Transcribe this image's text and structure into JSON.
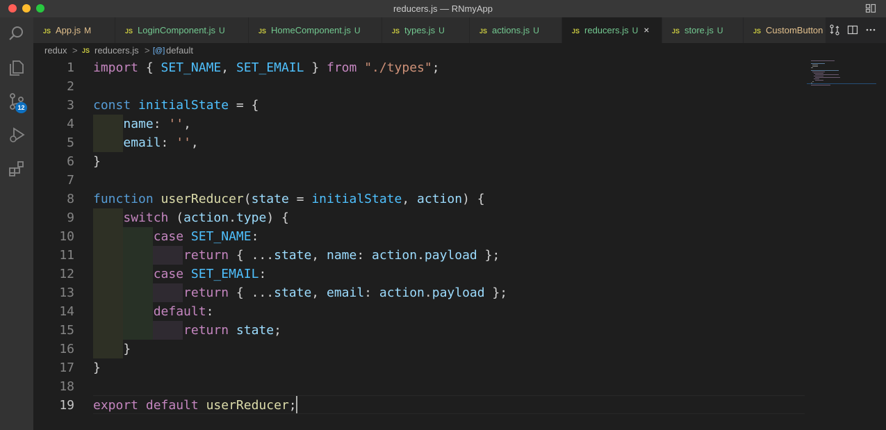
{
  "window": {
    "title": "reducers.js — RNmyApp"
  },
  "colors": {
    "accent": "#0e70c0",
    "modified": "#e2c08d",
    "untracked": "#73c991"
  },
  "activity_bar": {
    "items": [
      {
        "name": "explorer-icon"
      },
      {
        "name": "search-icon"
      },
      {
        "name": "source-control-icon"
      },
      {
        "name": "run-debug-icon"
      },
      {
        "name": "extensions-icon"
      }
    ],
    "source_control_badge": "12"
  },
  "tabs": [
    {
      "label": "App.js",
      "status": "M"
    },
    {
      "label": "LoginComponent.js",
      "status": "U"
    },
    {
      "label": "HomeComponent.js",
      "status": "U"
    },
    {
      "label": "types.js",
      "status": "U"
    },
    {
      "label": "actions.js",
      "status": "U"
    },
    {
      "label": "reducers.js",
      "status": "U",
      "active": true
    },
    {
      "label": "store.js",
      "status": "U"
    },
    {
      "label": "CustomButton",
      "status": ""
    }
  ],
  "tab_icon_label": "JS",
  "tab_close": "×",
  "breadcrumb": {
    "folder": "redux",
    "file": "reducers.js",
    "symbol": "default",
    "file_icon": "JS",
    "symbol_icon": "[@]",
    "separator": ">"
  },
  "editor": {
    "line_numbers": [
      "1",
      "2",
      "3",
      "4",
      "5",
      "6",
      "7",
      "8",
      "9",
      "10",
      "11",
      "12",
      "13",
      "14",
      "15",
      "16",
      "17",
      "18",
      "19"
    ],
    "current_line": "19",
    "lines": [
      {
        "tokens": [
          [
            "kw",
            "import"
          ],
          [
            "pn",
            " { "
          ],
          [
            "cn",
            "SET_NAME"
          ],
          [
            "pn",
            ", "
          ],
          [
            "cn",
            "SET_EMAIL"
          ],
          [
            "pn",
            " } "
          ],
          [
            "kw",
            "from"
          ],
          [
            "pn",
            " "
          ],
          [
            "str",
            "\"./types\""
          ],
          [
            "pn",
            ";"
          ]
        ]
      },
      {
        "tokens": []
      },
      {
        "tokens": [
          [
            "kb",
            "const"
          ],
          [
            "pn",
            " "
          ],
          [
            "cn",
            "initialState"
          ],
          [
            "pn",
            " = {"
          ]
        ]
      },
      {
        "tokens": [
          [
            "pn",
            "    "
          ],
          [
            "vr",
            "name"
          ],
          [
            "pn",
            ": "
          ],
          [
            "str",
            "''"
          ],
          [
            "pn",
            ","
          ]
        ]
      },
      {
        "tokens": [
          [
            "pn",
            "    "
          ],
          [
            "vr",
            "email"
          ],
          [
            "pn",
            ": "
          ],
          [
            "str",
            "''"
          ],
          [
            "pn",
            ","
          ]
        ]
      },
      {
        "tokens": [
          [
            "pn",
            "}"
          ]
        ]
      },
      {
        "tokens": []
      },
      {
        "tokens": [
          [
            "kb",
            "function"
          ],
          [
            "pn",
            " "
          ],
          [
            "fn",
            "userReducer"
          ],
          [
            "pn",
            "("
          ],
          [
            "vr",
            "state"
          ],
          [
            "pn",
            " = "
          ],
          [
            "cn",
            "initialState"
          ],
          [
            "pn",
            ", "
          ],
          [
            "vr",
            "action"
          ],
          [
            "pn",
            ") {"
          ]
        ]
      },
      {
        "tokens": [
          [
            "pn",
            "    "
          ],
          [
            "kw",
            "switch"
          ],
          [
            "pn",
            " ("
          ],
          [
            "vr",
            "action"
          ],
          [
            "pn",
            "."
          ],
          [
            "vr",
            "type"
          ],
          [
            "pn",
            ") {"
          ]
        ]
      },
      {
        "tokens": [
          [
            "pn",
            "        "
          ],
          [
            "kw",
            "case"
          ],
          [
            "pn",
            " "
          ],
          [
            "cn",
            "SET_NAME"
          ],
          [
            "pn",
            ":"
          ]
        ]
      },
      {
        "tokens": [
          [
            "pn",
            "            "
          ],
          [
            "kw",
            "return"
          ],
          [
            "pn",
            " { ..."
          ],
          [
            "vr",
            "state"
          ],
          [
            "pn",
            ", "
          ],
          [
            "vr",
            "name"
          ],
          [
            "pn",
            ": "
          ],
          [
            "vr",
            "action"
          ],
          [
            "pn",
            "."
          ],
          [
            "vr",
            "payload"
          ],
          [
            "pn",
            " };"
          ]
        ]
      },
      {
        "tokens": [
          [
            "pn",
            "        "
          ],
          [
            "kw",
            "case"
          ],
          [
            "pn",
            " "
          ],
          [
            "cn",
            "SET_EMAIL"
          ],
          [
            "pn",
            ":"
          ]
        ]
      },
      {
        "tokens": [
          [
            "pn",
            "            "
          ],
          [
            "kw",
            "return"
          ],
          [
            "pn",
            " { ..."
          ],
          [
            "vr",
            "state"
          ],
          [
            "pn",
            ", "
          ],
          [
            "vr",
            "email"
          ],
          [
            "pn",
            ": "
          ],
          [
            "vr",
            "action"
          ],
          [
            "pn",
            "."
          ],
          [
            "vr",
            "payload"
          ],
          [
            "pn",
            " };"
          ]
        ]
      },
      {
        "tokens": [
          [
            "pn",
            "        "
          ],
          [
            "kw",
            "default"
          ],
          [
            "pn",
            ":"
          ]
        ]
      },
      {
        "tokens": [
          [
            "pn",
            "            "
          ],
          [
            "kw",
            "return"
          ],
          [
            "pn",
            " "
          ],
          [
            "vr",
            "state"
          ],
          [
            "pn",
            ";"
          ]
        ]
      },
      {
        "tokens": [
          [
            "pn",
            "    }"
          ]
        ]
      },
      {
        "tokens": [
          [
            "pn",
            "}"
          ]
        ]
      },
      {
        "tokens": []
      },
      {
        "tokens": [
          [
            "kw",
            "export"
          ],
          [
            "pn",
            " "
          ],
          [
            "kw",
            "default"
          ],
          [
            "pn",
            " "
          ],
          [
            "fn",
            "userReducer"
          ],
          [
            "pn",
            ";"
          ]
        ]
      }
    ]
  }
}
